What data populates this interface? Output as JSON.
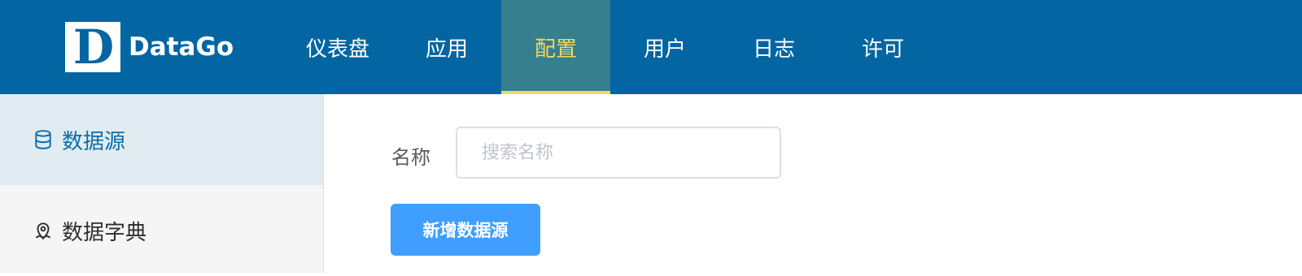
{
  "brand": {
    "mark": "D",
    "name": "DataGo"
  },
  "nav": {
    "items": [
      {
        "label": "仪表盘",
        "active": false
      },
      {
        "label": "应用",
        "active": false
      },
      {
        "label": "配置",
        "active": true
      },
      {
        "label": "用户",
        "active": false
      },
      {
        "label": "日志",
        "active": false
      },
      {
        "label": "许可",
        "active": false
      }
    ]
  },
  "sidebar": {
    "items": [
      {
        "label": "数据源",
        "icon": "database-icon",
        "active": true
      },
      {
        "label": "数据字典",
        "icon": "map-pin-icon",
        "active": false
      }
    ]
  },
  "main": {
    "name_label": "名称",
    "search_placeholder": "搜索名称",
    "search_value": "",
    "add_button": "新增数据源"
  },
  "colors": {
    "header_bg": "#0366a2",
    "active_tab_bg": "#367f8e",
    "active_tab_text": "#f2d661",
    "primary_button": "#409eff",
    "sidebar_active_bg": "#e0ecf1",
    "sidebar_active_text": "#0a6ea8"
  }
}
